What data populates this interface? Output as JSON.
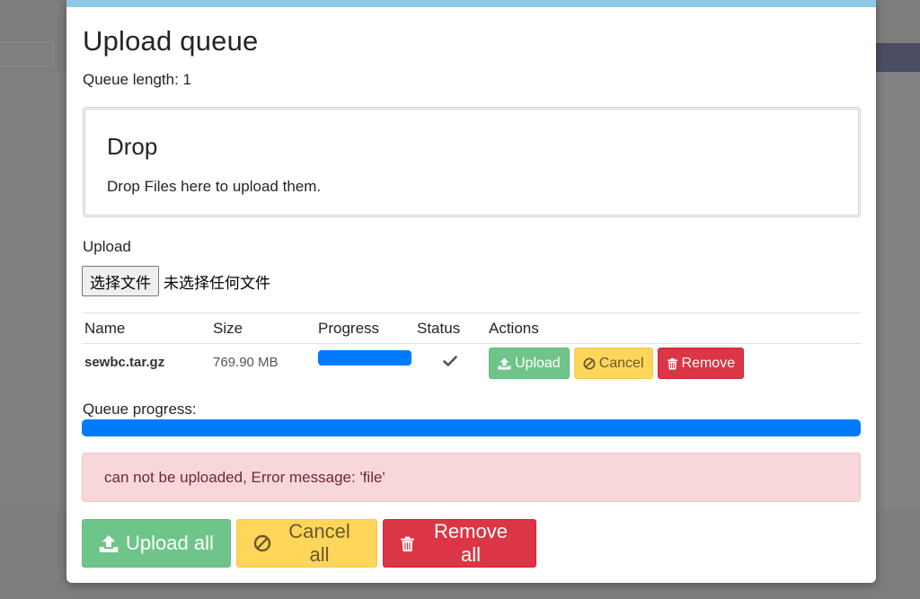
{
  "modal": {
    "title": "Upload queue",
    "queue_length_text": "Queue length: 1"
  },
  "drop_zone": {
    "title": "Drop",
    "hint": "Drop Files here to upload them."
  },
  "upload": {
    "label": "Upload",
    "choose_button": "选择文件",
    "no_file_text": "未选择任何文件"
  },
  "table": {
    "headers": [
      "Name",
      "Size",
      "Progress",
      "Status",
      "Actions"
    ],
    "rows": [
      {
        "name": "sewbc.tar.gz",
        "size": "769.90 MB",
        "progress_percent": 100,
        "status_icon": "check-icon",
        "actions": {
          "upload": "Upload",
          "cancel": "Cancel",
          "remove": "Remove"
        }
      }
    ]
  },
  "queue_progress": {
    "label": "Queue progress:",
    "percent": 100
  },
  "alert": {
    "message": "can not be uploaded, Error message: 'file'"
  },
  "footer": {
    "upload_all": "Upload all",
    "cancel_all": "Cancel all",
    "remove_all": "Remove all"
  },
  "colors": {
    "modal_topbar": "#8ecae6",
    "progress": "#007bff",
    "success": "#6fc48a",
    "warning": "#ffd65a",
    "danger": "#dc3545",
    "alert_bg": "#f8d7da"
  }
}
